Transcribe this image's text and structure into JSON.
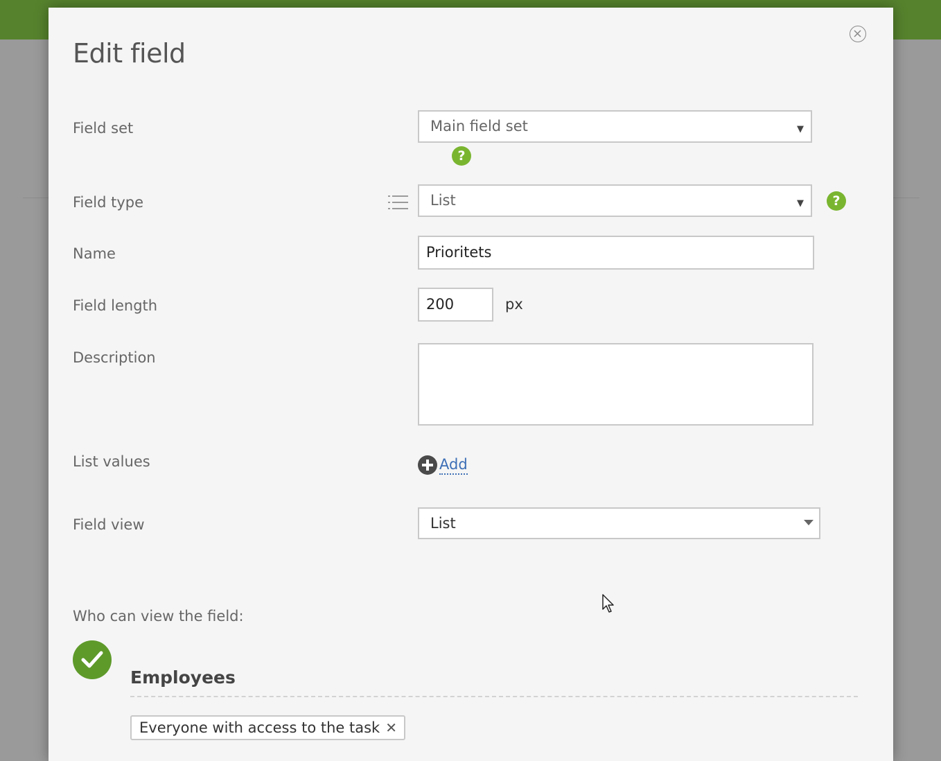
{
  "dialog": {
    "title": "Edit field",
    "close_icon": "close-circle-icon"
  },
  "fields": {
    "field_set": {
      "label": "Field set",
      "value": "Main field set",
      "help_icon": "help-icon"
    },
    "field_type": {
      "label": "Field type",
      "value": "List",
      "list_icon": "list-icon",
      "help_icon": "help-icon"
    },
    "name": {
      "label": "Name",
      "value": "Prioritets"
    },
    "field_length": {
      "label": "Field length",
      "value": "200",
      "unit": "px"
    },
    "description": {
      "label": "Description",
      "value": ""
    },
    "list_values": {
      "label": "List values",
      "add_label": "Add",
      "add_icon": "plus-circle-icon"
    },
    "field_view": {
      "label": "Field view",
      "value": "List"
    }
  },
  "visibility": {
    "heading": "Who can view the field:",
    "group": {
      "name": "Employees",
      "checked": true,
      "check_icon": "checkmark-icon",
      "tags": [
        {
          "label": "Everyone with access to the task",
          "remove_symbol": "✕"
        }
      ]
    }
  },
  "colors": {
    "accent_green": "#7ab530",
    "check_green": "#5e9a2a",
    "topbar_green": "#56822d",
    "link_blue": "#3d6fb6"
  }
}
